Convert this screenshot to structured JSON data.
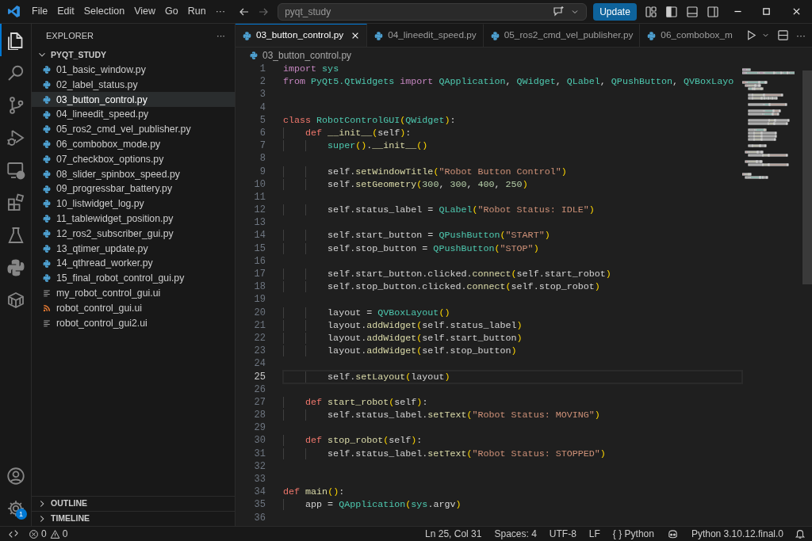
{
  "title_bar": {
    "menus": [
      "File",
      "Edit",
      "Selection",
      "View",
      "Go",
      "Run"
    ],
    "more": "···",
    "search": "pyqt_study",
    "update_button": "Update"
  },
  "activity_bar": {
    "items": [
      {
        "kind": "explorer",
        "selected": true
      },
      {
        "kind": "search",
        "selected": false
      },
      {
        "kind": "source-control",
        "selected": false
      },
      {
        "kind": "run-debug",
        "selected": false
      },
      {
        "kind": "remote",
        "selected": false
      },
      {
        "kind": "extensions",
        "selected": false
      },
      {
        "kind": "testing",
        "selected": false
      },
      {
        "kind": "python",
        "selected": false
      },
      {
        "kind": "container",
        "selected": false
      }
    ],
    "settings_badge": "1"
  },
  "sidebar": {
    "title": "EXPLORER",
    "more": "···",
    "folder": {
      "name": "PYQT_STUDY",
      "expanded": true,
      "files": [
        {
          "name": "01_basic_window.py",
          "kind": "python",
          "selected": false
        },
        {
          "name": "02_label_status.py",
          "kind": "python",
          "selected": false
        },
        {
          "name": "03_button_control.py",
          "kind": "python",
          "selected": true
        },
        {
          "name": "04_lineedit_speed.py",
          "kind": "python",
          "selected": false
        },
        {
          "name": "05_ros2_cmd_vel_publisher.py",
          "kind": "python",
          "selected": false
        },
        {
          "name": "06_combobox_mode.py",
          "kind": "python",
          "selected": false
        },
        {
          "name": "07_checkbox_options.py",
          "kind": "python",
          "selected": false
        },
        {
          "name": "08_slider_spinbox_speed.py",
          "kind": "python",
          "selected": false
        },
        {
          "name": "09_progressbar_battery.py",
          "kind": "python",
          "selected": false
        },
        {
          "name": "10_listwidget_log.py",
          "kind": "python",
          "selected": false
        },
        {
          "name": "11_tablewidget_position.py",
          "kind": "python",
          "selected": false
        },
        {
          "name": "12_ros2_subscriber_gui.py",
          "kind": "python",
          "selected": false
        },
        {
          "name": "13_qtimer_update.py",
          "kind": "python",
          "selected": false
        },
        {
          "name": "14_qthread_worker.py",
          "kind": "python",
          "selected": false
        },
        {
          "name": "15_final_robot_control_gui.py",
          "kind": "python",
          "selected": false
        },
        {
          "name": "my_robot_control_gui.ui",
          "kind": "text",
          "selected": false
        },
        {
          "name": "robot_control_gui.ui",
          "kind": "feed",
          "selected": false
        },
        {
          "name": "robot_control_gui2.ui",
          "kind": "text",
          "selected": false
        }
      ]
    },
    "sections": [
      {
        "label": "OUTLINE",
        "expanded": false
      },
      {
        "label": "TIMELINE",
        "expanded": false
      }
    ]
  },
  "editor": {
    "tabs": [
      {
        "label": "03_button_control.py",
        "selected": true
      },
      {
        "label": "04_lineedit_speed.py",
        "selected": false
      },
      {
        "label": "05_ros2_cmd_vel_publisher.py",
        "selected": false
      },
      {
        "label": "06_combobox_m",
        "selected": false
      }
    ],
    "more": "···",
    "breadcrumb": "03_button_control.py",
    "lines": [
      {
        "number": "1",
        "current": false,
        "tokens": [
          {
            "text": "import",
            "kind": "keyword"
          },
          {
            "text": " sys",
            "kind": "class"
          }
        ]
      },
      {
        "number": "2",
        "current": false,
        "tokens": [
          {
            "text": "from",
            "kind": "keyword"
          },
          {
            "text": " PyQt5.QtWidgets",
            "kind": "class"
          },
          {
            "text": " import",
            "kind": "keyword"
          },
          {
            "text": " QApplication",
            "kind": "class"
          },
          {
            "text": ",",
            "kind": "plain"
          },
          {
            "text": " QWidget",
            "kind": "class"
          },
          {
            "text": ",",
            "kind": "plain"
          },
          {
            "text": " QLabel",
            "kind": "class"
          },
          {
            "text": ",",
            "kind": "plain"
          },
          {
            "text": " QPushButton",
            "kind": "class"
          },
          {
            "text": ",",
            "kind": "plain"
          },
          {
            "text": " QVBoxLayo",
            "kind": "class"
          }
        ]
      },
      {
        "number": "3",
        "current": false
      },
      {
        "number": "4",
        "current": false
      },
      {
        "number": "5",
        "current": false,
        "tokens": [
          {
            "text": "class",
            "kind": "storage"
          },
          {
            "text": " RobotControlGUI",
            "kind": "class"
          },
          {
            "text": "(",
            "kind": "bracket"
          },
          {
            "text": "QWidget",
            "kind": "class"
          },
          {
            "text": ")",
            "kind": "bracket"
          },
          {
            "text": ":",
            "kind": "plain"
          }
        ]
      },
      {
        "number": "6",
        "current": false,
        "tokens": [
          {
            "text": "    def",
            "kind": "storage"
          },
          {
            "text": " __init__",
            "kind": "function"
          },
          {
            "text": "(",
            "kind": "bracket"
          },
          {
            "text": "self",
            "kind": "plain"
          },
          {
            "text": ")",
            "kind": "bracket"
          },
          {
            "text": ":",
            "kind": "plain"
          }
        ]
      },
      {
        "number": "7",
        "current": false,
        "tokens": [
          {
            "text": "        super",
            "kind": "class"
          },
          {
            "text": "()",
            "kind": "bracket"
          },
          {
            "text": ".",
            "kind": "plain"
          },
          {
            "text": "__init__",
            "kind": "function"
          },
          {
            "text": "()",
            "kind": "bracket"
          }
        ]
      },
      {
        "number": "8",
        "current": false
      },
      {
        "number": "9",
        "current": false,
        "tokens": [
          {
            "text": "        self.",
            "kind": "plain"
          },
          {
            "text": "setWindowTitle",
            "kind": "function"
          },
          {
            "text": "(",
            "kind": "bracket"
          },
          {
            "text": "\"Robot Button Control\"",
            "kind": "string"
          },
          {
            "text": ")",
            "kind": "bracket"
          }
        ]
      },
      {
        "number": "10",
        "current": false,
        "tokens": [
          {
            "text": "        self.",
            "kind": "plain"
          },
          {
            "text": "setGeometry",
            "kind": "function"
          },
          {
            "text": "(",
            "kind": "bracket"
          },
          {
            "text": "300",
            "kind": "number"
          },
          {
            "text": ",",
            "kind": "plain"
          },
          {
            "text": " 300",
            "kind": "number"
          },
          {
            "text": ",",
            "kind": "plain"
          },
          {
            "text": " 400",
            "kind": "number"
          },
          {
            "text": ",",
            "kind": "plain"
          },
          {
            "text": " 250",
            "kind": "number"
          },
          {
            "text": ")",
            "kind": "bracket"
          }
        ]
      },
      {
        "number": "11",
        "current": false
      },
      {
        "number": "12",
        "current": false,
        "tokens": [
          {
            "text": "        self.status_label =",
            "kind": "plain"
          },
          {
            "text": " QLabel",
            "kind": "class"
          },
          {
            "text": "(",
            "kind": "bracket"
          },
          {
            "text": "\"Robot Status: IDLE\"",
            "kind": "string"
          },
          {
            "text": ")",
            "kind": "bracket"
          }
        ]
      },
      {
        "number": "13",
        "current": false
      },
      {
        "number": "14",
        "current": false,
        "tokens": [
          {
            "text": "        self.start_button =",
            "kind": "plain"
          },
          {
            "text": " QPushButton",
            "kind": "class"
          },
          {
            "text": "(",
            "kind": "bracket"
          },
          {
            "text": "\"START\"",
            "kind": "string"
          },
          {
            "text": ")",
            "kind": "bracket"
          }
        ]
      },
      {
        "number": "15",
        "current": false,
        "tokens": [
          {
            "text": "        self.stop_button =",
            "kind": "plain"
          },
          {
            "text": " QPushButton",
            "kind": "class"
          },
          {
            "text": "(",
            "kind": "bracket"
          },
          {
            "text": "\"STOP\"",
            "kind": "string"
          },
          {
            "text": ")",
            "kind": "bracket"
          }
        ]
      },
      {
        "number": "16",
        "current": false
      },
      {
        "number": "17",
        "current": false,
        "tokens": [
          {
            "text": "        self.start_button.clicked.",
            "kind": "plain"
          },
          {
            "text": "connect",
            "kind": "function"
          },
          {
            "text": "(",
            "kind": "bracket"
          },
          {
            "text": "self.start_robot",
            "kind": "plain"
          },
          {
            "text": ")",
            "kind": "bracket"
          }
        ]
      },
      {
        "number": "18",
        "current": false,
        "tokens": [
          {
            "text": "        self.stop_button.clicked.",
            "kind": "plain"
          },
          {
            "text": "connect",
            "kind": "function"
          },
          {
            "text": "(",
            "kind": "bracket"
          },
          {
            "text": "self.stop_robot",
            "kind": "plain"
          },
          {
            "text": ")",
            "kind": "bracket"
          }
        ]
      },
      {
        "number": "19",
        "current": false
      },
      {
        "number": "20",
        "current": false,
        "tokens": [
          {
            "text": "        layout =",
            "kind": "plain"
          },
          {
            "text": " QVBoxLayout",
            "kind": "class"
          },
          {
            "text": "()",
            "kind": "bracket"
          }
        ]
      },
      {
        "number": "21",
        "current": false,
        "tokens": [
          {
            "text": "        layout.",
            "kind": "plain"
          },
          {
            "text": "addWidget",
            "kind": "function"
          },
          {
            "text": "(",
            "kind": "bracket"
          },
          {
            "text": "self.status_label",
            "kind": "plain"
          },
          {
            "text": ")",
            "kind": "bracket"
          }
        ]
      },
      {
        "number": "22",
        "current": false,
        "tokens": [
          {
            "text": "        layout.",
            "kind": "plain"
          },
          {
            "text": "addWidget",
            "kind": "function"
          },
          {
            "text": "(",
            "kind": "bracket"
          },
          {
            "text": "self.start_button",
            "kind": "plain"
          },
          {
            "text": ")",
            "kind": "bracket"
          }
        ]
      },
      {
        "number": "23",
        "current": false,
        "tokens": [
          {
            "text": "        layout.",
            "kind": "plain"
          },
          {
            "text": "addWidget",
            "kind": "function"
          },
          {
            "text": "(",
            "kind": "bracket"
          },
          {
            "text": "self.stop_button",
            "kind": "plain"
          },
          {
            "text": ")",
            "kind": "bracket"
          }
        ]
      },
      {
        "number": "24",
        "current": false
      },
      {
        "number": "25",
        "current": true,
        "tokens": [
          {
            "text": "        self.",
            "kind": "plain"
          },
          {
            "text": "setLayout",
            "kind": "function"
          },
          {
            "text": "(",
            "kind": "bracket"
          },
          {
            "text": "layout",
            "kind": "plain"
          },
          {
            "text": ")",
            "kind": "bracket"
          }
        ]
      },
      {
        "number": "26",
        "current": false
      },
      {
        "number": "27",
        "current": false,
        "tokens": [
          {
            "text": "    def",
            "kind": "storage"
          },
          {
            "text": " start_robot",
            "kind": "function"
          },
          {
            "text": "(",
            "kind": "bracket"
          },
          {
            "text": "self",
            "kind": "plain"
          },
          {
            "text": ")",
            "kind": "bracket"
          },
          {
            "text": ":",
            "kind": "plain"
          }
        ]
      },
      {
        "number": "28",
        "current": false,
        "tokens": [
          {
            "text": "        self.status_label.",
            "kind": "plain"
          },
          {
            "text": "setText",
            "kind": "function"
          },
          {
            "text": "(",
            "kind": "bracket"
          },
          {
            "text": "\"Robot Status: MOVING\"",
            "kind": "string"
          },
          {
            "text": ")",
            "kind": "bracket"
          }
        ]
      },
      {
        "number": "29",
        "current": false
      },
      {
        "number": "30",
        "current": false,
        "tokens": [
          {
            "text": "    def",
            "kind": "storage"
          },
          {
            "text": " stop_robot",
            "kind": "function"
          },
          {
            "text": "(",
            "kind": "bracket"
          },
          {
            "text": "self",
            "kind": "plain"
          },
          {
            "text": ")",
            "kind": "bracket"
          },
          {
            "text": ":",
            "kind": "plain"
          }
        ]
      },
      {
        "number": "31",
        "current": false,
        "tokens": [
          {
            "text": "        self.status_label.",
            "kind": "plain"
          },
          {
            "text": "setText",
            "kind": "function"
          },
          {
            "text": "(",
            "kind": "bracket"
          },
          {
            "text": "\"Robot Status: STOPPED\"",
            "kind": "string"
          },
          {
            "text": ")",
            "kind": "bracket"
          }
        ]
      },
      {
        "number": "32",
        "current": false
      },
      {
        "number": "33",
        "current": false
      },
      {
        "number": "34",
        "current": false,
        "tokens": [
          {
            "text": "def",
            "kind": "storage"
          },
          {
            "text": " main",
            "kind": "function"
          },
          {
            "text": "()",
            "kind": "bracket"
          },
          {
            "text": ":",
            "kind": "plain"
          }
        ]
      },
      {
        "number": "35",
        "current": false,
        "tokens": [
          {
            "text": "    app =",
            "kind": "plain"
          },
          {
            "text": " QApplication",
            "kind": "class"
          },
          {
            "text": "(",
            "kind": "bracket"
          },
          {
            "text": "sys",
            "kind": "class"
          },
          {
            "text": ".argv",
            "kind": "plain"
          },
          {
            "text": ")",
            "kind": "bracket"
          }
        ]
      },
      {
        "number": "36",
        "current": false
      }
    ]
  },
  "status_bar": {
    "errors": "0",
    "warnings": "0",
    "items": [
      "Ln 25, Col 31",
      "Spaces: 4",
      "UTF-8",
      "LF"
    ],
    "language": "{ } Python",
    "interpreter": "Python 3.10.12.final.0"
  }
}
